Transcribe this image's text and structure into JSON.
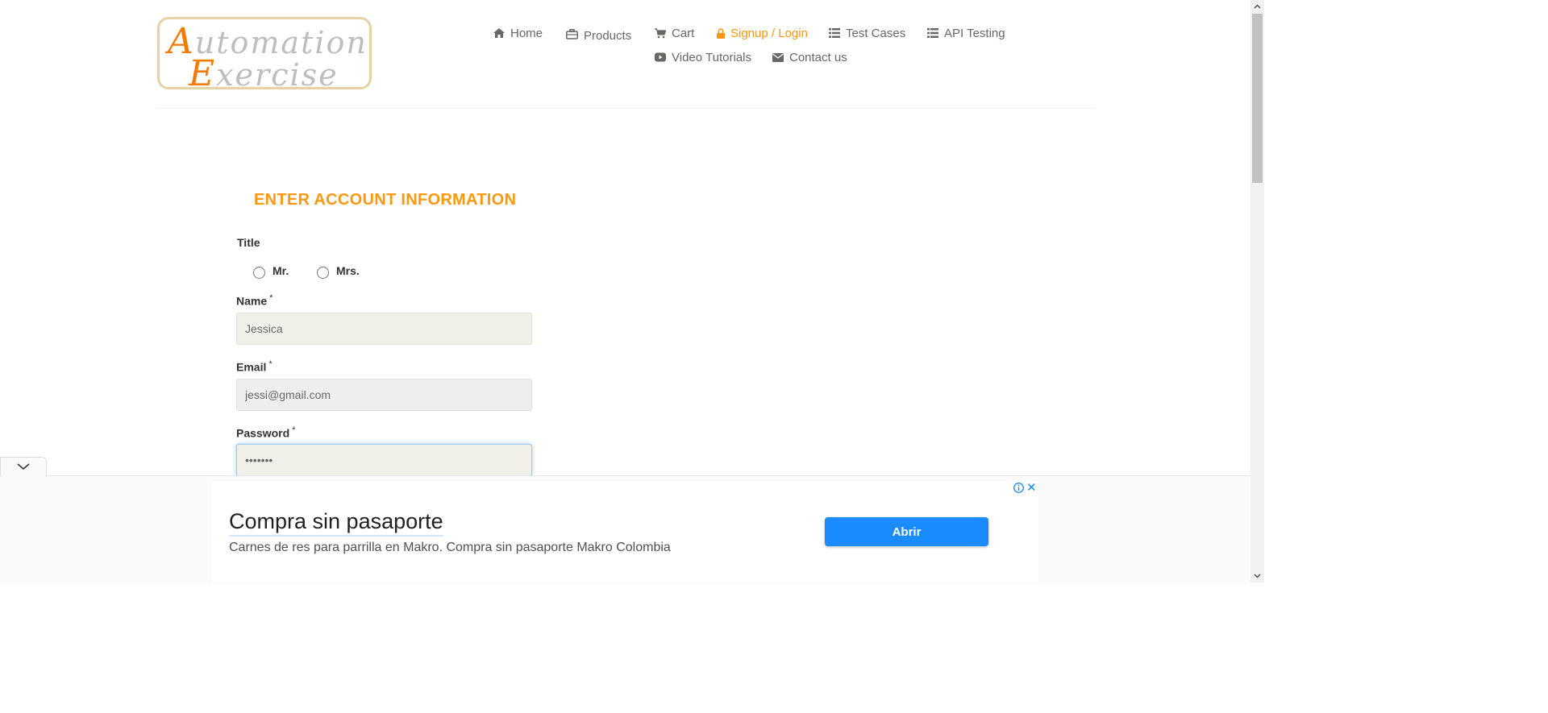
{
  "logo": {
    "line1_cap": "A",
    "line1_rest": "utomation",
    "line2_cap": "E",
    "line2_rest": "xercise"
  },
  "nav": {
    "items": [
      {
        "label": "Home",
        "icon": "home-icon"
      },
      {
        "label": "Products",
        "icon": "briefcase-icon"
      },
      {
        "label": "Cart",
        "icon": "cart-icon"
      },
      {
        "label": "Signup / Login",
        "icon": "lock-icon",
        "active": true
      },
      {
        "label": "Test Cases",
        "icon": "list-icon"
      },
      {
        "label": "API Testing",
        "icon": "list-icon"
      },
      {
        "label": "Video Tutorials",
        "icon": "youtube-play-icon"
      },
      {
        "label": "Contact us",
        "icon": "envelope-icon"
      }
    ]
  },
  "form": {
    "heading": "ENTER ACCOUNT INFORMATION",
    "title_label": "Title",
    "title_options": [
      "Mr.",
      "Mrs."
    ],
    "name_label": "Name",
    "name_value": "Jessica",
    "email_label": "Email",
    "email_value": "jessi@gmail.com",
    "password_label": "Password",
    "password_value": "•••••••",
    "required_mark": "*"
  },
  "ad": {
    "title": "Compra sin pasaporte",
    "description": "Carnes de res para parrilla en Makro. Compra sin pasaporte Makro Colombia",
    "button": "Abrir",
    "close": "✕"
  },
  "colors": {
    "accent": "#fe980f",
    "ad_button": "#1a8cff"
  }
}
